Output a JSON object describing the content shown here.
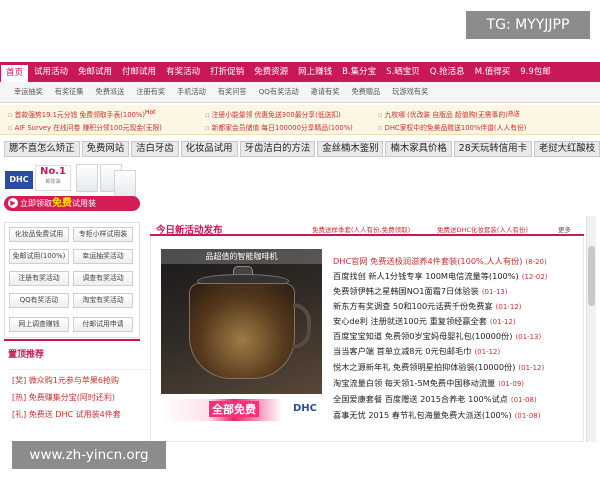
{
  "badges": {
    "tg": "TG: MYYJJPP",
    "site": "www.zh-yincn.org"
  },
  "nav": {
    "items": [
      "首页",
      "试用活动",
      "免邮试用",
      "付邮试用",
      "有奖活动",
      "打折促销",
      "免费资源",
      "网上赚钱",
      "B.集分宝",
      "S.晒宝贝",
      "Q.抢活息",
      "M.值得买",
      "9.9包邮"
    ],
    "active": 0,
    "color": "#c8185a"
  },
  "subnav": {
    "items": [
      "幸运抽奖",
      "有奖征集",
      "免费派送",
      "注册有奖",
      "手机活动",
      "有奖问答",
      "QQ有奖活动",
      "邀请有奖",
      "免费赠品",
      "玩游戏有奖"
    ]
  },
  "announcements": [
    {
      "text": "首款强势19.1元分钱 免费领取手表(100%)",
      "hot": "Hot"
    },
    {
      "text": "注册小能量领 优惠免送300最分享(低送扣)"
    },
    {
      "text": "九枚哪 (优改装 自版品 超值购(无需事的)",
      "hot": "热送"
    },
    {
      "text": "AIF Survey 在线问卷 赚积分领100元现金(无限)"
    },
    {
      "text": "新都家会员储值 每日100000分享精品(100%)"
    },
    {
      "text": "DHC家权中的免美品赠送100%伴谱(人人有份)"
    }
  ],
  "keywords": [
    "腮不直怎么矫正",
    "免费网站",
    "洁白牙齿",
    "化妆品试用",
    "牙齿洁白的方法",
    "金丝楠木鉴别",
    "楠木家具价格",
    "28天玩转信用卡",
    "老挝大红酸枝"
  ],
  "dhc": {
    "logo": "DHC",
    "no1_big": "No.1",
    "no1_small": "卸妆油"
  },
  "free_button": {
    "prefix": "立即领取",
    "highlight": "免费",
    "suffix": "试用装"
  },
  "side_menu": [
    "化妆品免费试用",
    "专柜小样试用装",
    "免邮试用(100%)",
    "幸运抽奖活动",
    "注册有奖活动",
    "调查有奖活动",
    "QQ有奖活动",
    "淘宝有奖活动",
    "网上调查赚钱",
    "付邮试用申请"
  ],
  "side_news": {
    "title": "置顶推荐",
    "items": [
      "[奖] 微众购1元参与苹果6抢购",
      "[热] 免费赚集分宝(阿时还利)",
      "[礼] 免费送 DHC 试用装4件套"
    ]
  },
  "main": {
    "title": "今日新活动发布",
    "head_links": [
      "免费送样季套(人人有份,免费领取)",
      "免费送DHC化妆套装(人人有份)"
    ],
    "more": "更多",
    "feature_caption": "品超值的智能咖啡机",
    "banner": {
      "text": "全部免费",
      "brand": "DHC"
    },
    "news": [
      {
        "text": "DHC官网 免费送极润滋养4件套装(100%,人人有份)",
        "date": "(8-20)",
        "red": true
      },
      {
        "text": "百度找创 新人1分钱专享 100M电信流量等(100%)",
        "date": "(12-02)"
      },
      {
        "text": "免费领伊韩之星韩国NO1面霜7日体验装",
        "date": "(01-13)"
      },
      {
        "text": "新东方有奖调查 50和100元话费千份免费宴",
        "date": "(01-12)"
      },
      {
        "text": "安心de利 注册就送100元 重复领经赢全套",
        "date": "(01-12)"
      },
      {
        "text": "百度宝宝知道 免费领0岁宝妈母婴礼包(10000份)",
        "date": "(01-13)"
      },
      {
        "text": "当当客户端 首单立减8元 0元包邮毛巾",
        "date": "(01-12)"
      },
      {
        "text": "悦木之源新年礼 免费领明星拍抑体验装(10000份)",
        "date": "(01-12)"
      },
      {
        "text": "淘宝流量白领 每天领1-5M免费中国移动流量",
        "date": "(01-09)"
      },
      {
        "text": "全国爱康套餐 百度赠送 2015合养老 100%试点",
        "date": "(01-08)"
      },
      {
        "text": "喜事无忧 2015 春节礼包海量免费大派送(100%)",
        "date": "(01-08)"
      }
    ]
  }
}
